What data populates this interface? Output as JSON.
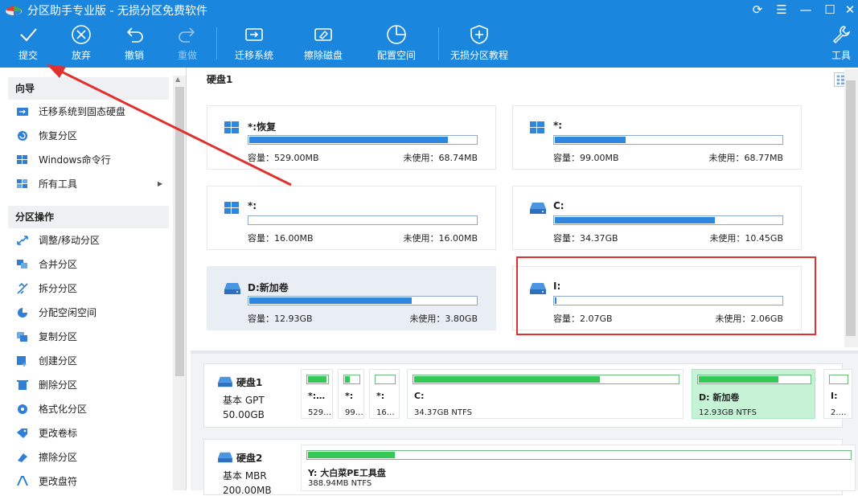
{
  "window": {
    "title": "分区助手专业版 - 无损分区免费软件",
    "controls": {
      "refresh": "⟳",
      "menu": "☰",
      "minimize": "—",
      "maximize": "☐",
      "close": "✕"
    }
  },
  "toolbar": {
    "commit": "提交",
    "discard": "放弃",
    "undo": "撤销",
    "redo": "重做",
    "migrate_os": "迁移系统",
    "wipe_disk": "擦除磁盘",
    "allocate_space": "配置空间",
    "tutorial": "无损分区教程",
    "tools": "工具"
  },
  "sidebar": {
    "wizard_header": "向导",
    "wizard_items": [
      {
        "label": "迁移系统到固态硬盘",
        "icon": "migrate-ssd-icon"
      },
      {
        "label": "恢复分区",
        "icon": "recover-partition-icon"
      },
      {
        "label": "Windows命令行",
        "icon": "windows-cmd-icon"
      },
      {
        "label": "所有工具",
        "icon": "all-tools-icon"
      }
    ],
    "ops_header": "分区操作",
    "ops_items": [
      {
        "label": "调整/移动分区",
        "icon": "resize-move-icon"
      },
      {
        "label": "合并分区",
        "icon": "merge-icon"
      },
      {
        "label": "拆分分区",
        "icon": "split-icon"
      },
      {
        "label": "分配空闲空间",
        "icon": "allocate-free-icon"
      },
      {
        "label": "复制分区",
        "icon": "copy-partition-icon"
      },
      {
        "label": "创建分区",
        "icon": "create-partition-icon"
      },
      {
        "label": "删除分区",
        "icon": "delete-partition-icon"
      },
      {
        "label": "格式化分区",
        "icon": "format-icon"
      },
      {
        "label": "更改卷标",
        "icon": "label-tag-icon"
      },
      {
        "label": "擦除分区",
        "icon": "wipe-partition-icon"
      },
      {
        "label": "更改盘符",
        "icon": "drive-letter-icon"
      }
    ]
  },
  "disk1_label": "硬盘1",
  "partition_cards": [
    {
      "name": "*:恢复",
      "type": "windows",
      "fill": 0.87,
      "capacity": "容量：529.00MB",
      "unused": "未使用：68.74MB",
      "selected": false
    },
    {
      "name": "*:",
      "type": "windows",
      "fill": 0.31,
      "capacity": "容量：99.00MB",
      "unused": "未使用：68.77MB",
      "selected": false
    },
    {
      "name": "*:",
      "type": "windows",
      "fill": 0.0,
      "capacity": "容量：16.00MB",
      "unused": "未使用：16.00MB",
      "selected": false
    },
    {
      "name": "C:",
      "type": "drive",
      "fill": 0.7,
      "capacity": "容量：34.37GB",
      "unused": "未使用：10.45GB",
      "selected": false
    },
    {
      "name": "D:新加卷",
      "type": "drive",
      "fill": 0.71,
      "capacity": "容量：12.93GB",
      "unused": "未使用：3.80GB",
      "selected": true
    },
    {
      "name": "I:",
      "type": "drive",
      "fill": 0.005,
      "capacity": "容量：2.07GB",
      "unused": "未使用：2.06GB",
      "selected": false
    }
  ],
  "disk_map": [
    {
      "name": "硬盘1",
      "type": "基本 GPT",
      "size": "50.00GB",
      "partitions": [
        {
          "name": "*:…",
          "detail": "529…",
          "fill": 0.87
        },
        {
          "name": "*:",
          "detail": "99…",
          "fill": 0.31
        },
        {
          "name": "*:",
          "detail": "16…",
          "fill": 0.0
        },
        {
          "name": "C:",
          "detail": "34.37GB NTFS",
          "fill": 0.7
        },
        {
          "name": "D: 新加卷",
          "detail": "12.93GB NTFS",
          "fill": 0.71,
          "selected": true
        },
        {
          "name": "I:",
          "detail": "2.…",
          "fill": 0.0
        }
      ]
    },
    {
      "name": "硬盘2",
      "type": "基本 MBR",
      "size": "200.00MB",
      "partitions": [
        {
          "name": "Y: 大白菜PE工具盘",
          "detail": "388.94MB NTFS",
          "fill": 0.16
        }
      ]
    }
  ],
  "colors": {
    "accent": "#1b86dd",
    "bar_blue": "#2f86de",
    "bar_green": "#34c956",
    "selected_green": "#c6f3d6",
    "annotation_red": "#e03131"
  }
}
